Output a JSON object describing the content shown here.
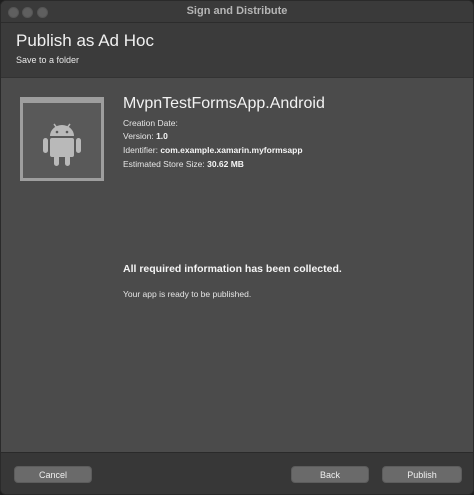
{
  "window": {
    "title": "Sign and Distribute"
  },
  "header": {
    "title": "Publish as Ad Hoc",
    "subtitle": "Save to a folder"
  },
  "app": {
    "icon": "android-icon",
    "name": "MvpnTestFormsApp.Android",
    "creation_date_label": "Creation Date:",
    "creation_date_value": "",
    "version_label": "Version:",
    "version_value": "1.0",
    "identifier_label": "Identifier:",
    "identifier_value": "com.example.xamarin.myformsapp",
    "size_label": "Estimated Store Size:",
    "size_value": "30.62 MB"
  },
  "status": {
    "headline": "All required information has been collected.",
    "message": "Your app is ready to be published."
  },
  "buttons": {
    "cancel": "Cancel",
    "back": "Back",
    "publish": "Publish"
  }
}
